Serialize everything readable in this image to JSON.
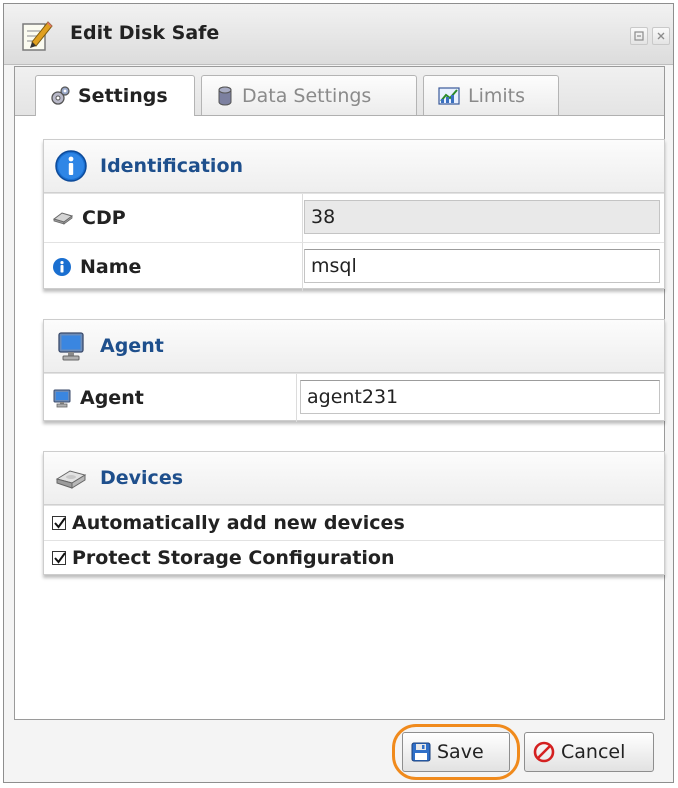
{
  "window": {
    "title": "Edit Disk Safe"
  },
  "tabs": [
    {
      "label": "Settings",
      "icon": "gear-icon",
      "active": true
    },
    {
      "label": "Data Settings",
      "icon": "database-icon",
      "active": false
    },
    {
      "label": "Limits",
      "icon": "chart-icon",
      "active": false
    }
  ],
  "identification": {
    "title": "Identification",
    "rows": [
      {
        "label": "CDP",
        "value": "38",
        "icon": "disk-icon",
        "readonly": true
      },
      {
        "label": "Name",
        "value": "msql",
        "icon": "info-icon",
        "readonly": false
      }
    ]
  },
  "agent": {
    "title": "Agent",
    "row": {
      "label": "Agent",
      "value": "agent231",
      "icon": "computer-icon"
    }
  },
  "devices": {
    "title": "Devices",
    "options": [
      {
        "label": "Automatically add new devices",
        "checked": true
      },
      {
        "label": "Protect Storage Configuration",
        "checked": true
      }
    ]
  },
  "footer": {
    "save_label": "Save",
    "cancel_label": "Cancel"
  },
  "colors": {
    "accent": "#1e4f8c",
    "highlight": "#f08a1c"
  }
}
